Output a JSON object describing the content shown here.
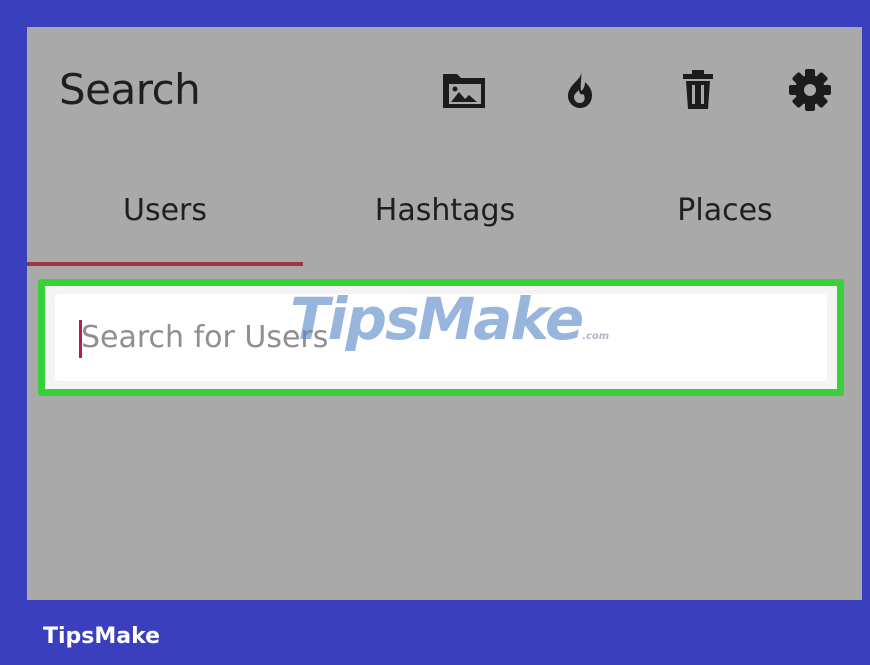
{
  "header": {
    "title": "Search",
    "actions": [
      {
        "icon": "image-folder-icon"
      },
      {
        "icon": "flame-icon"
      },
      {
        "icon": "trash-icon"
      },
      {
        "icon": "gear-icon"
      }
    ]
  },
  "tabs": [
    {
      "label": "Users",
      "selected": true
    },
    {
      "label": "Hashtags",
      "selected": false
    },
    {
      "label": "Places",
      "selected": false
    }
  ],
  "search": {
    "placeholder": "Search for Users",
    "value": ""
  },
  "watermark": {
    "text": "TipsMake",
    "suffix": ".com"
  },
  "footer": {
    "brand": "TipsMake"
  },
  "colors": {
    "frame": "#3a3fbd",
    "background": "#a9a9a9",
    "tab_indicator": "#9a3741",
    "highlight": "#39d13b"
  }
}
